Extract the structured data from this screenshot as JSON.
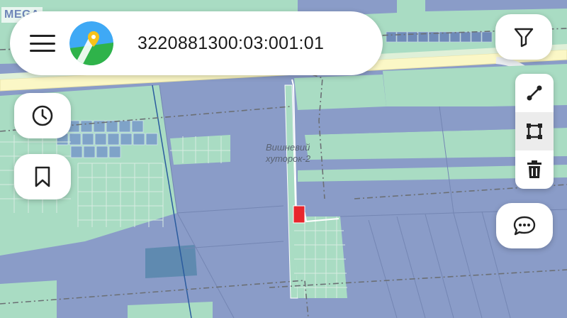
{
  "watermark": "MEGA",
  "search": {
    "cadastral_number": "3220881300:03:001:01"
  },
  "map": {
    "place_label_line1": "Вишневий",
    "place_label_line2": "хуторок-2",
    "highlight_color": "#e8262c"
  },
  "icons": {
    "menu": "menu-icon",
    "logo": "map-app-logo",
    "history": "clock-icon",
    "bookmark": "bookmark-icon",
    "filter": "filter-icon",
    "measure": "ruler-line-icon",
    "area": "polygon-icon",
    "delete": "trash-icon",
    "chat": "chat-bubble-icon"
  },
  "colors": {
    "parcel_blue": "#8a9cc8",
    "parcel_green": "#a9dfc4",
    "road_yellow": "#fbf7c6",
    "accent": "#2e7ac4"
  }
}
